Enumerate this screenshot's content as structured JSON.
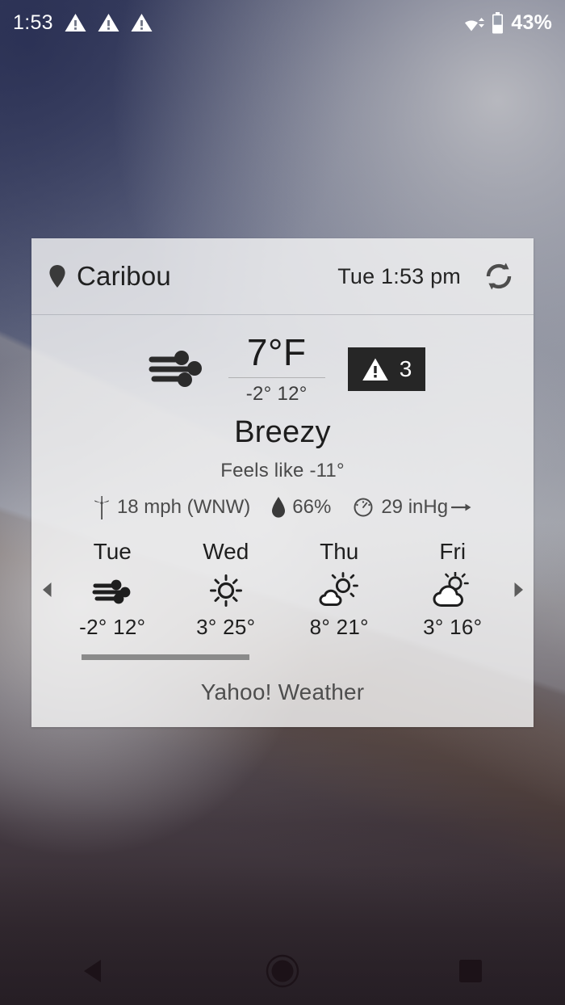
{
  "statusbar": {
    "time": "1:53",
    "battery_percent": "43%",
    "icons": [
      "warning-triangle",
      "warning-triangle",
      "warning-triangle",
      "wifi",
      "battery"
    ],
    "warning_count": 3
  },
  "widget": {
    "header": {
      "location_icon": "location-pin-icon",
      "city": "Caribou",
      "datetime": "Tue 1:53 pm",
      "refresh_icon": "refresh-icon"
    },
    "current": {
      "condition_icon": "windy-icon",
      "temperature": "7°F",
      "temp_range": "-2° 12°",
      "alert_icon": "warning-triangle-icon",
      "alert_count": "3",
      "alert_bg": "#262626",
      "condition": "Breezy",
      "feels_like": "Feels like -11°"
    },
    "metrics": [
      {
        "icon": "wind-turbine-icon",
        "value": "18 mph (WNW)"
      },
      {
        "icon": "water-drop-icon",
        "value": "66%"
      },
      {
        "icon": "barometer-gauge-icon",
        "value": "29 inHg"
      }
    ],
    "pressure_trend_icon": "arrow-right-icon",
    "forecast": {
      "prev_icon": "chevron-left-icon",
      "next_icon": "chevron-right-icon",
      "days": [
        {
          "name": "Tue",
          "icon": "windy-icon",
          "temps": "-2° 12°"
        },
        {
          "name": "Wed",
          "icon": "sunny-icon",
          "temps": "3° 25°"
        },
        {
          "name": "Thu",
          "icon": "partly-sunny-icon",
          "temps": "8° 21°"
        },
        {
          "name": "Fri",
          "icon": "mostly-cloudy-icon",
          "temps": "3° 16°"
        }
      ]
    },
    "attribution": "Yahoo! Weather"
  },
  "navbar": {
    "back": "back-button",
    "home": "home-button",
    "recents": "recents-button"
  }
}
